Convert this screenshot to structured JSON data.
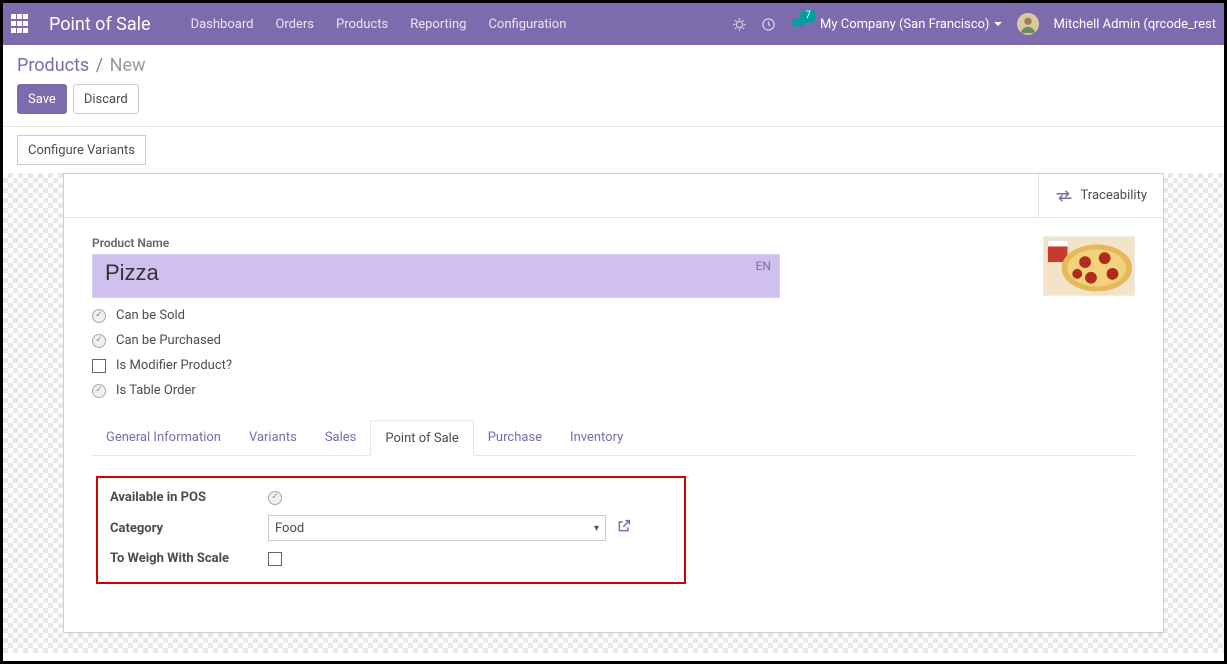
{
  "topbar": {
    "app_title": "Point of Sale",
    "menu": [
      "Dashboard",
      "Orders",
      "Products",
      "Reporting",
      "Configuration"
    ],
    "chat_badge": "7",
    "company": "My Company (San Francisco)",
    "user": "Mitchell Admin (qrcode_rest"
  },
  "breadcrumb": {
    "root": "Products",
    "current": "New"
  },
  "buttons": {
    "save": "Save",
    "discard": "Discard",
    "configure_variants": "Configure Variants"
  },
  "stat_buttons": {
    "traceability": "Traceability"
  },
  "product": {
    "name_label": "Product Name",
    "name_value": "Pizza",
    "lang": "EN",
    "can_be_sold_label": "Can be Sold",
    "can_be_purchased_label": "Can be Purchased",
    "is_modifier_label": "Is Modifier Product?",
    "is_table_order_label": "Is Table Order",
    "can_be_sold": true,
    "can_be_purchased": true,
    "is_modifier": false,
    "is_table_order": true
  },
  "tabs": {
    "general": "General Information",
    "variants": "Variants",
    "sales": "Sales",
    "pos": "Point of Sale",
    "purchase": "Purchase",
    "inventory": "Inventory"
  },
  "pos_tab": {
    "available_label": "Available in POS",
    "available": true,
    "category_label": "Category",
    "category_value": "Food",
    "to_weigh_label": "To Weigh With Scale",
    "to_weigh": false
  },
  "colors": {
    "primary": "#7c6bad"
  }
}
